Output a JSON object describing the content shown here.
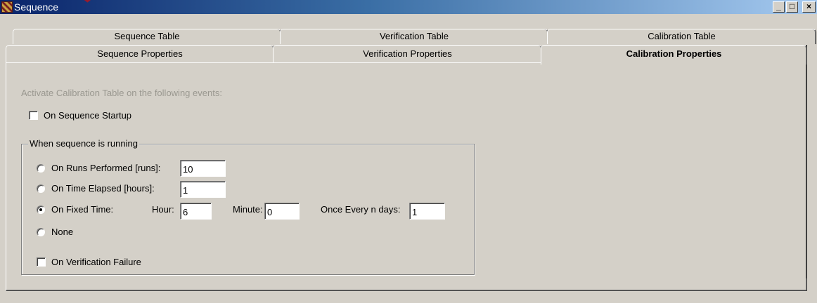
{
  "window": {
    "title": "Sequence",
    "minimize": "_",
    "maximize": "□",
    "close": "×"
  },
  "tabs_row1": [
    "Sequence Table",
    "Verification Table",
    "Calibration Table"
  ],
  "tabs_row2": [
    "Sequence Properties",
    "Verification Properties",
    "Calibration Properties"
  ],
  "active_tab": "Calibration Properties",
  "content": {
    "instruction": "Activate Calibration Table on the following events:",
    "on_startup_label": "On Sequence Startup",
    "on_startup_checked": false,
    "group_label": "When sequence is running",
    "runs_label": "On Runs Performed [runs]:",
    "runs_value": "10",
    "time_label": "On Time Elapsed [hours]:",
    "time_value": "1",
    "fixed_label": "On Fixed Time:",
    "hour_label": "Hour:",
    "hour_value": "6",
    "minute_label": "Minute:",
    "minute_value": "0",
    "days_label": "Once Every n days:",
    "days_value": "1",
    "none_label": "None",
    "verification_failure_label": "On Verification Failure",
    "verification_failure_checked": false,
    "selected_option": "fixed"
  },
  "watermark": "www.",
  "colors": {
    "face": "#d4d0c8",
    "title_start": "#0a246a",
    "title_end": "#a6caf0",
    "watermark": "#c81414"
  }
}
